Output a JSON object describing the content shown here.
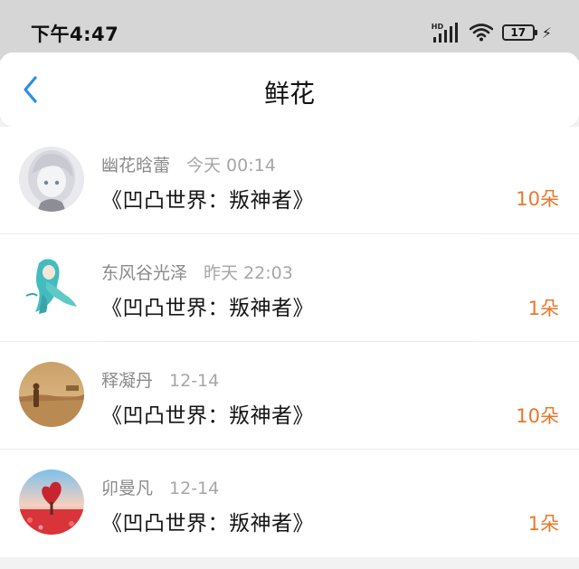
{
  "status_bar": {
    "time": "下午4:47",
    "network": "HD",
    "battery_level": "17",
    "icons": [
      "signal-icon",
      "wifi-icon",
      "battery-icon",
      "charging-icon"
    ]
  },
  "header": {
    "back_icon": "chevron-left-icon",
    "title": "鲜花"
  },
  "colors": {
    "accent": "#2f8de4",
    "count": "#e8782a"
  },
  "gifts": [
    {
      "user": "幽花晗蕾",
      "time": "今天 00:14",
      "book": "《凹凸世界：叛神者》",
      "count": "10朵",
      "avatar": "avatar-anime-girl"
    },
    {
      "user": "东风谷光泽",
      "time": "昨天 22:03",
      "book": "《凹凸世界：叛神者》",
      "count": "1朵",
      "avatar": "avatar-green-hair"
    },
    {
      "user": "释凝丹",
      "time": "12-14",
      "book": "《凹凸世界：叛神者》",
      "count": "10朵",
      "avatar": "avatar-desert"
    },
    {
      "user": "卯曼凡",
      "time": "12-14",
      "book": "《凹凸世界：叛神者》",
      "count": "1朵",
      "avatar": "avatar-heart-tree"
    }
  ]
}
